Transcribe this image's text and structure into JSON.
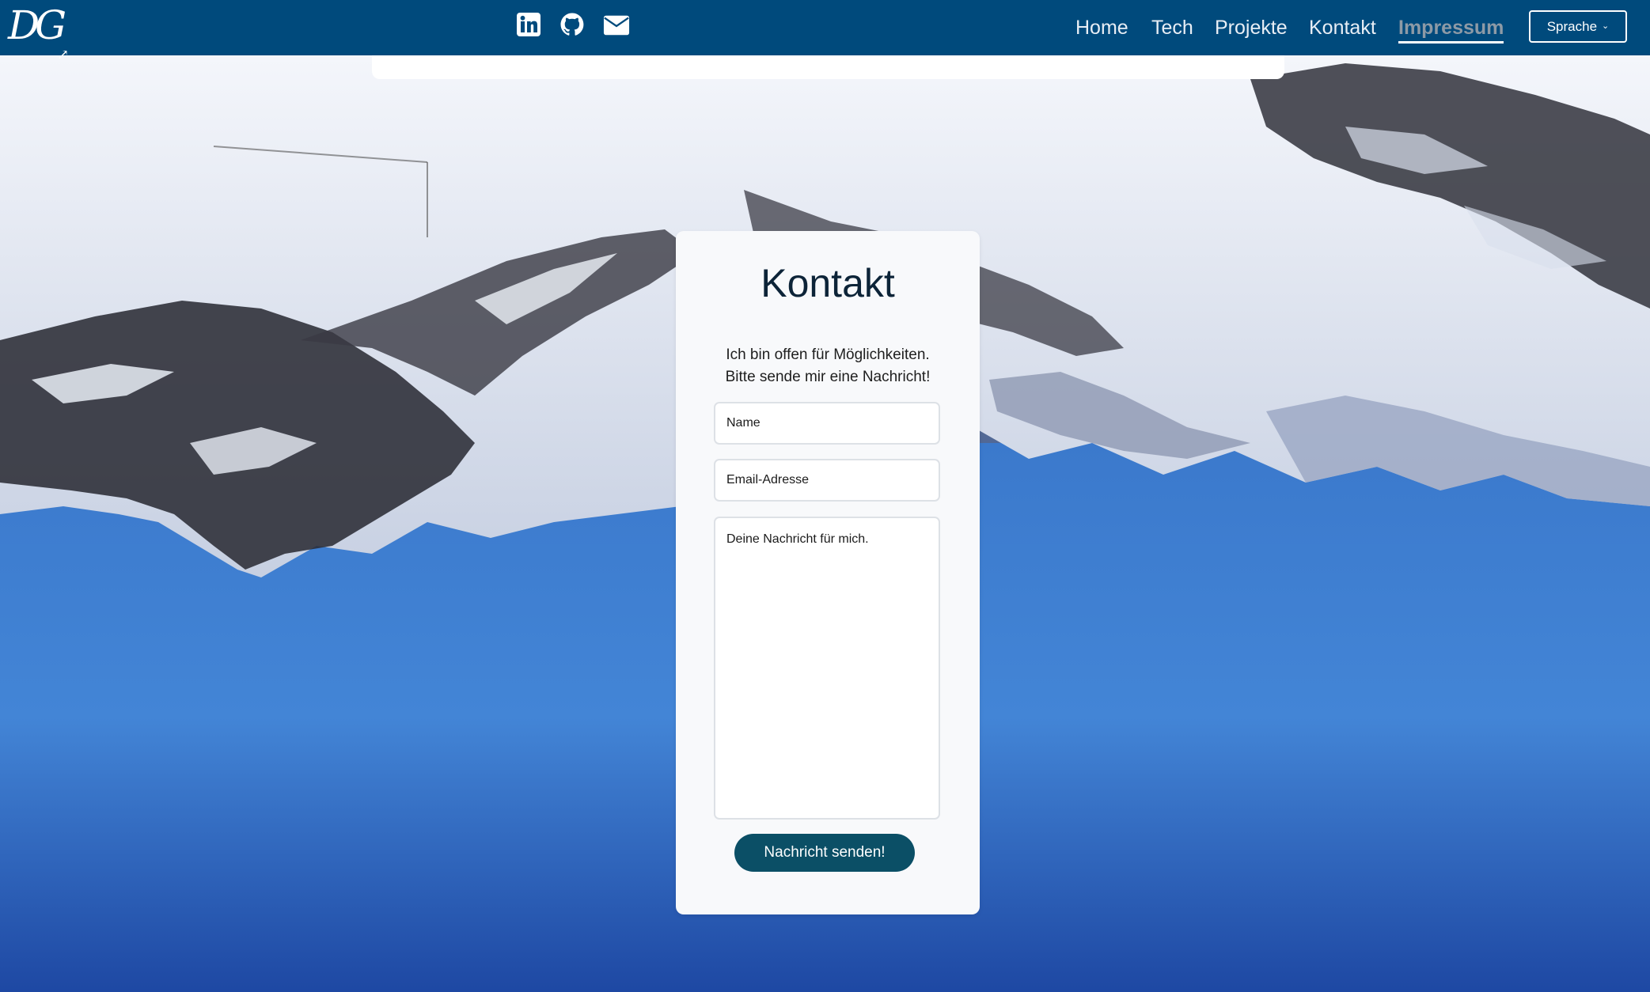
{
  "brand": {
    "logo_text": "DG",
    "logo_mark": "↗"
  },
  "social": [
    {
      "icon": "linkedin-icon"
    },
    {
      "icon": "github-icon"
    },
    {
      "icon": "envelope-icon"
    }
  ],
  "nav": {
    "items": [
      {
        "label": "Home"
      },
      {
        "label": "Tech"
      },
      {
        "label": "Projekte"
      },
      {
        "label": "Kontakt"
      },
      {
        "label": "Impressum",
        "active": true
      }
    ],
    "language_button": "Sprache",
    "language_chevron": "⌄"
  },
  "contact": {
    "title": "Kontakt",
    "intro_line1": "Ich bin offen für Möglichkeiten.",
    "intro_line2": "Bitte sende mir eine Nachricht!",
    "name_placeholder": "Name",
    "email_placeholder": "Email-Adresse",
    "message_placeholder": "Deine Nachricht für mich.",
    "submit_label": "Nachricht senden!"
  },
  "colors": {
    "navbar": "#004a7c",
    "button": "#0b4f66",
    "card": "#f8f9fb",
    "active_link": "#8d9aa6"
  }
}
